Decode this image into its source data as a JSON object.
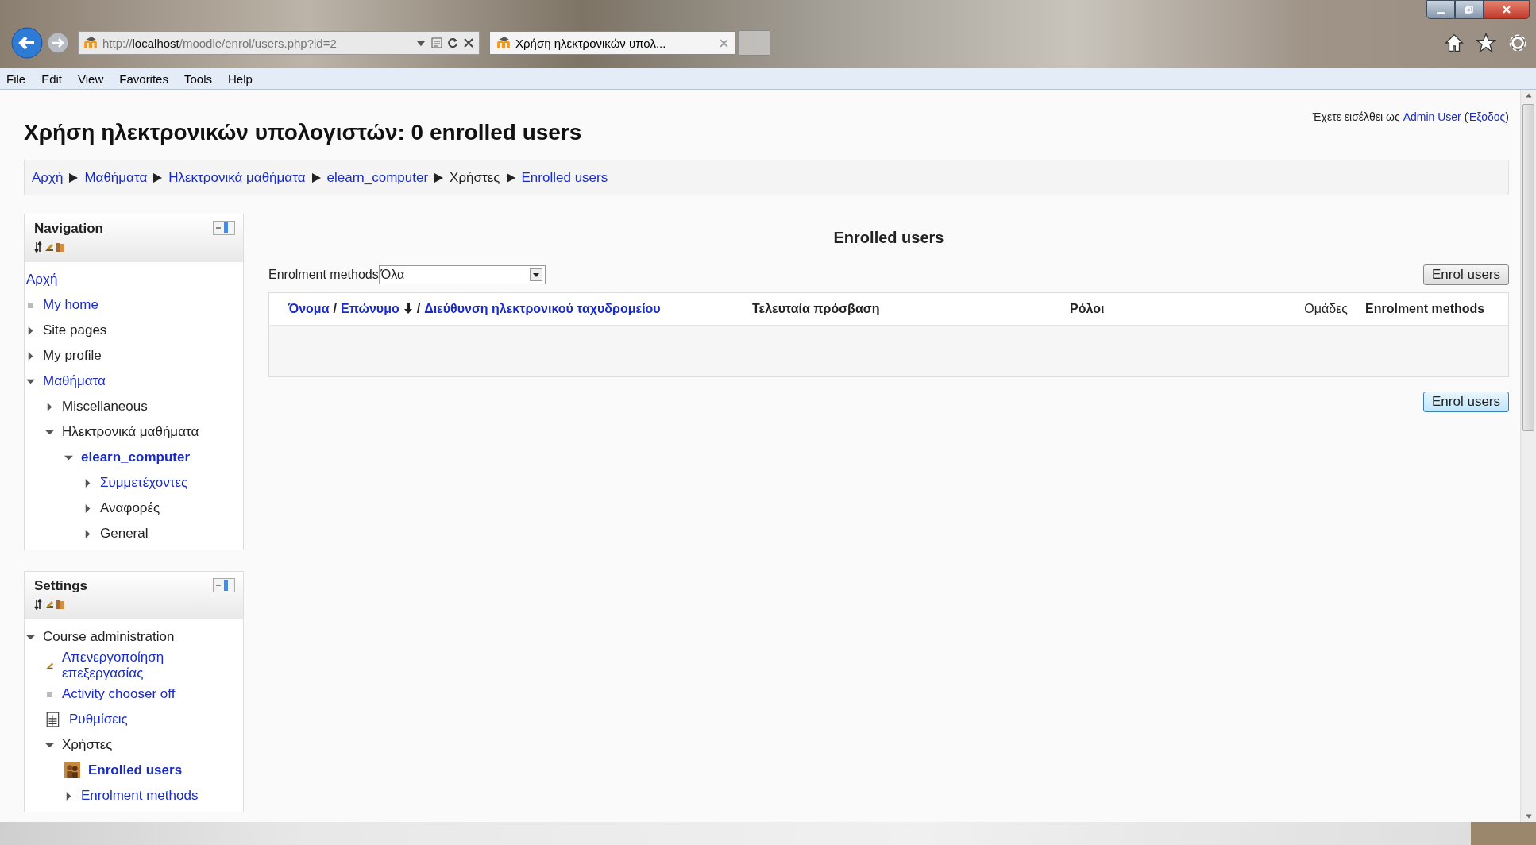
{
  "browser": {
    "address": {
      "scheme": "http://",
      "host": "localhost",
      "path": "/moodle/enrol/users.php?id=2"
    },
    "tab": {
      "title": "Χρήση ηλεκτρονικών υπολ...",
      "selected": true
    },
    "menu": [
      "File",
      "Edit",
      "View",
      "Favorites",
      "Tools",
      "Help"
    ]
  },
  "page": {
    "title": "Χρήση ηλεκτρονικών υπολογιστών: 0 enrolled users",
    "login": {
      "text": "Έχετε εισέλθει ως ",
      "user": "Admin User",
      "open": " (",
      "logout": "Έξοδος",
      "close": ")"
    },
    "breadcrumb": [
      {
        "text": "Αρχή",
        "link": true
      },
      {
        "text": "Μαθήματα",
        "link": true
      },
      {
        "text": "Ηλεκτρονικά μαθήματα",
        "link": true
      },
      {
        "text": "elearn_computer",
        "link": true
      },
      {
        "text": "Χρήστες",
        "link": false
      },
      {
        "text": "Enrolled users",
        "link": true
      }
    ],
    "blocks": [
      {
        "title": "Navigation",
        "items": [
          {
            "label": "Αρχή",
            "kind": "plain",
            "link": true,
            "selected": false
          },
          {
            "label": "My home",
            "kind": "bullet",
            "link": true,
            "selected": false
          },
          {
            "label": "Site pages",
            "kind": "arrow",
            "expanded": false,
            "link": false,
            "selected": false
          },
          {
            "label": "My profile",
            "kind": "arrow",
            "expanded": false,
            "link": false,
            "selected": false
          },
          {
            "label": "Μαθήματα",
            "kind": "arrow",
            "expanded": true,
            "link": true,
            "selected": false,
            "children": [
              {
                "label": "Miscellaneous",
                "kind": "arrow",
                "expanded": false,
                "link": false,
                "selected": false
              },
              {
                "label": "Ηλεκτρονικά μαθήματα",
                "kind": "arrow",
                "expanded": true,
                "link": false,
                "selected": false,
                "children": [
                  {
                    "label": "elearn_computer",
                    "kind": "arrow",
                    "expanded": true,
                    "link": true,
                    "selected": true,
                    "children": [
                      {
                        "label": "Συμμετέχοντες",
                        "kind": "arrow",
                        "expanded": false,
                        "link": true,
                        "selected": false
                      },
                      {
                        "label": "Αναφορές",
                        "kind": "arrow",
                        "expanded": false,
                        "link": false,
                        "selected": false
                      },
                      {
                        "label": "General",
                        "kind": "arrow",
                        "expanded": false,
                        "link": false,
                        "selected": false
                      }
                    ]
                  }
                ]
              }
            ]
          }
        ]
      },
      {
        "title": "Settings",
        "items": [
          {
            "label": "Course administration",
            "kind": "arrow",
            "expanded": true,
            "link": false,
            "selected": false,
            "children": [
              {
                "label": "Απενεργοποίηση επεξεργασίας",
                "kind": "edit",
                "link": true,
                "selected": false
              },
              {
                "label": "Activity chooser off",
                "kind": "bullet",
                "link": true,
                "selected": false
              },
              {
                "label": "Ρυθμίσεις",
                "kind": "settings",
                "link": true,
                "selected": false
              },
              {
                "label": "Χρήστες",
                "kind": "arrow",
                "expanded": true,
                "link": false,
                "selected": false,
                "children": [
                  {
                    "label": "Enrolled users",
                    "kind": "users",
                    "link": true,
                    "selected": true
                  },
                  {
                    "label": "Enrolment methods",
                    "kind": "arrow",
                    "expanded": false,
                    "link": true,
                    "selected": false
                  }
                ]
              }
            ]
          }
        ]
      }
    ],
    "main": {
      "heading": "Enrolled users",
      "filter": {
        "label": "Enrolment methods",
        "value": "Όλα"
      },
      "enrol_buttons": [
        "Enrol users",
        "Enrol users"
      ],
      "table": {
        "columns": [
          {
            "parts": [
              {
                "text": "Όνομα",
                "kind": "link"
              },
              {
                "text": "/",
                "kind": "sep"
              },
              {
                "text": "Επώνυμο",
                "kind": "link",
                "sorted": true
              },
              {
                "text": "/",
                "kind": "sep"
              },
              {
                "text": "Διεύθυνση ηλεκτρονικού ταχυδρομείου",
                "kind": "link"
              }
            ]
          },
          {
            "label": "Τελευταία πρόσβαση"
          },
          {
            "label": "Ρόλοι"
          },
          {
            "label": "Ομάδες"
          },
          {
            "label": "Enrolment methods"
          }
        ]
      }
    }
  }
}
